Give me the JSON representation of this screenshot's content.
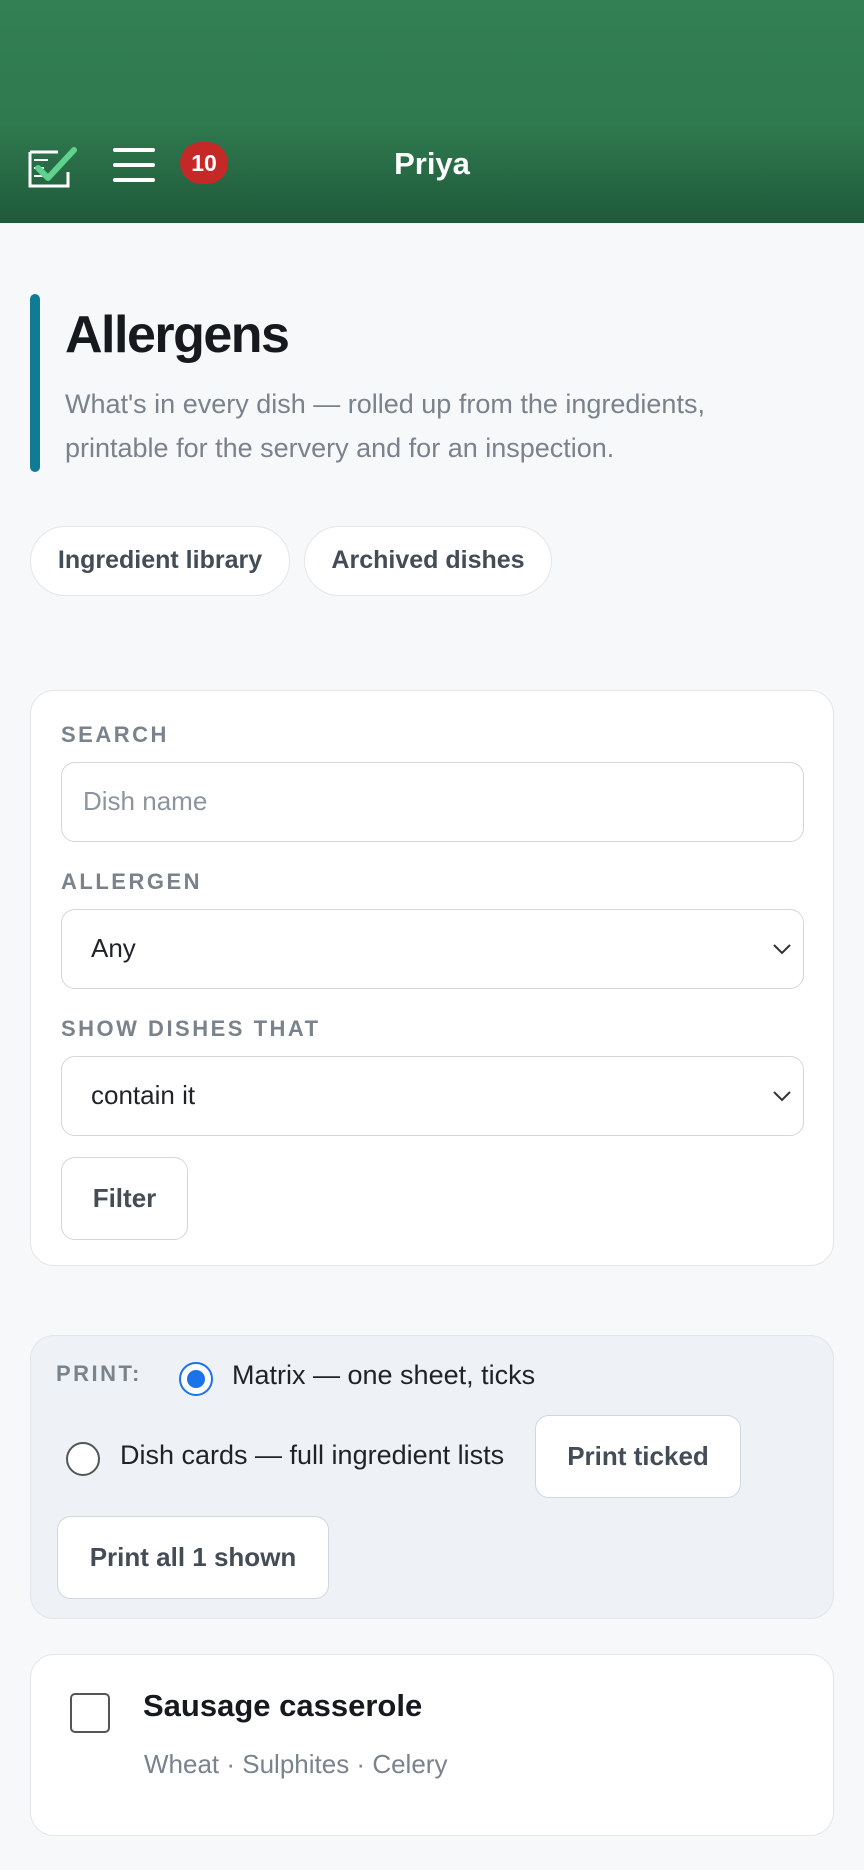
{
  "topbar": {
    "badge_count": "10",
    "user_name": "Priya",
    "icons": [
      "checklist-icon",
      "hamburger-menu-icon"
    ]
  },
  "page": {
    "title": "Allergens",
    "subtitle": "What's in every dish — rolled up from the ingredients, printable for the servery and for an inspection."
  },
  "links": {
    "ingredient_library": "Ingredient library",
    "archived_dishes": "Archived dishes"
  },
  "filters": {
    "search_label": "SEARCH",
    "search_placeholder": "Dish name",
    "search_value": "",
    "allergen_label": "ALLERGEN",
    "allergen_value": "Any",
    "show_label": "SHOW DISHES THAT",
    "show_value": "contain it",
    "filter_button": "Filter"
  },
  "print": {
    "label": "PRINT:",
    "options": [
      {
        "label": "Matrix — one sheet, ticks",
        "selected": true
      },
      {
        "label": "Dish cards — full ingredient lists",
        "selected": false
      }
    ],
    "print_ticked": "Print ticked",
    "print_all": "Print all 1 shown"
  },
  "dishes": [
    {
      "name": "Sausage casserole",
      "allergens": "Wheat · Sulphites · Celery",
      "checked": false
    }
  ],
  "colors": {
    "header_green": "#2f7a4f",
    "badge_red": "#c62828",
    "accent_teal": "#0f7b94",
    "radio_blue": "#1a73e8"
  }
}
